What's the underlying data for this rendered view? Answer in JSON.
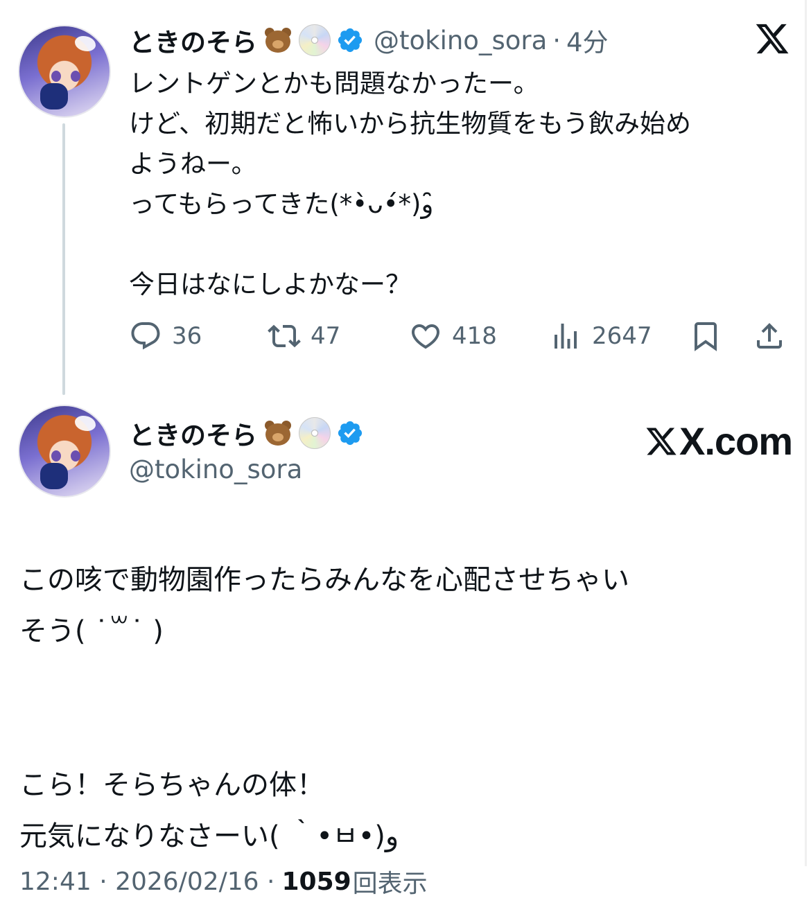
{
  "reply_tweet": {
    "display_name": "ときのそら",
    "handle": "@tokino_sora",
    "separator": "·",
    "time_ago": "4分",
    "text": "レントゲンとかも問題なかったー。\nけど、初期だと怖いから抗生物質をもう飲み始め\nようねー。\nってもらってきた(*•̀ᴗ•́*)و ̑̑\n\n今日はなにしよかなー？",
    "actions": {
      "replies": "36",
      "reposts": "47",
      "likes": "418",
      "views": "2647"
    }
  },
  "main_tweet": {
    "display_name": "ときのそら",
    "handle": "@tokino_sora",
    "brand": "X.com",
    "text": "この咳で動物園作ったらみんなを心配させちゃい\nそう( ˙꒳˙ )\n\n\nこら！そらちゃんの体！\n元気になりなさーい( ｀•ㅂ•)و",
    "timestamp": "12:41 · 2026/02/16 ·",
    "views_count": "1059",
    "views_label": "回表示"
  },
  "icons": {
    "badge_color": "#1d9bf0",
    "emoji_1": "bear-face-emoji",
    "emoji_2": "optical-disc-emoji",
    "reply": "reply-icon",
    "repost": "repost-icon",
    "like": "heart-icon",
    "views": "views-icon",
    "bookmark": "bookmark-icon",
    "share": "share-icon",
    "logo": "x-logo-icon"
  },
  "colors": {
    "text": "#0f1419",
    "secondary": "#536471",
    "thread_line": "#cfd9de"
  }
}
